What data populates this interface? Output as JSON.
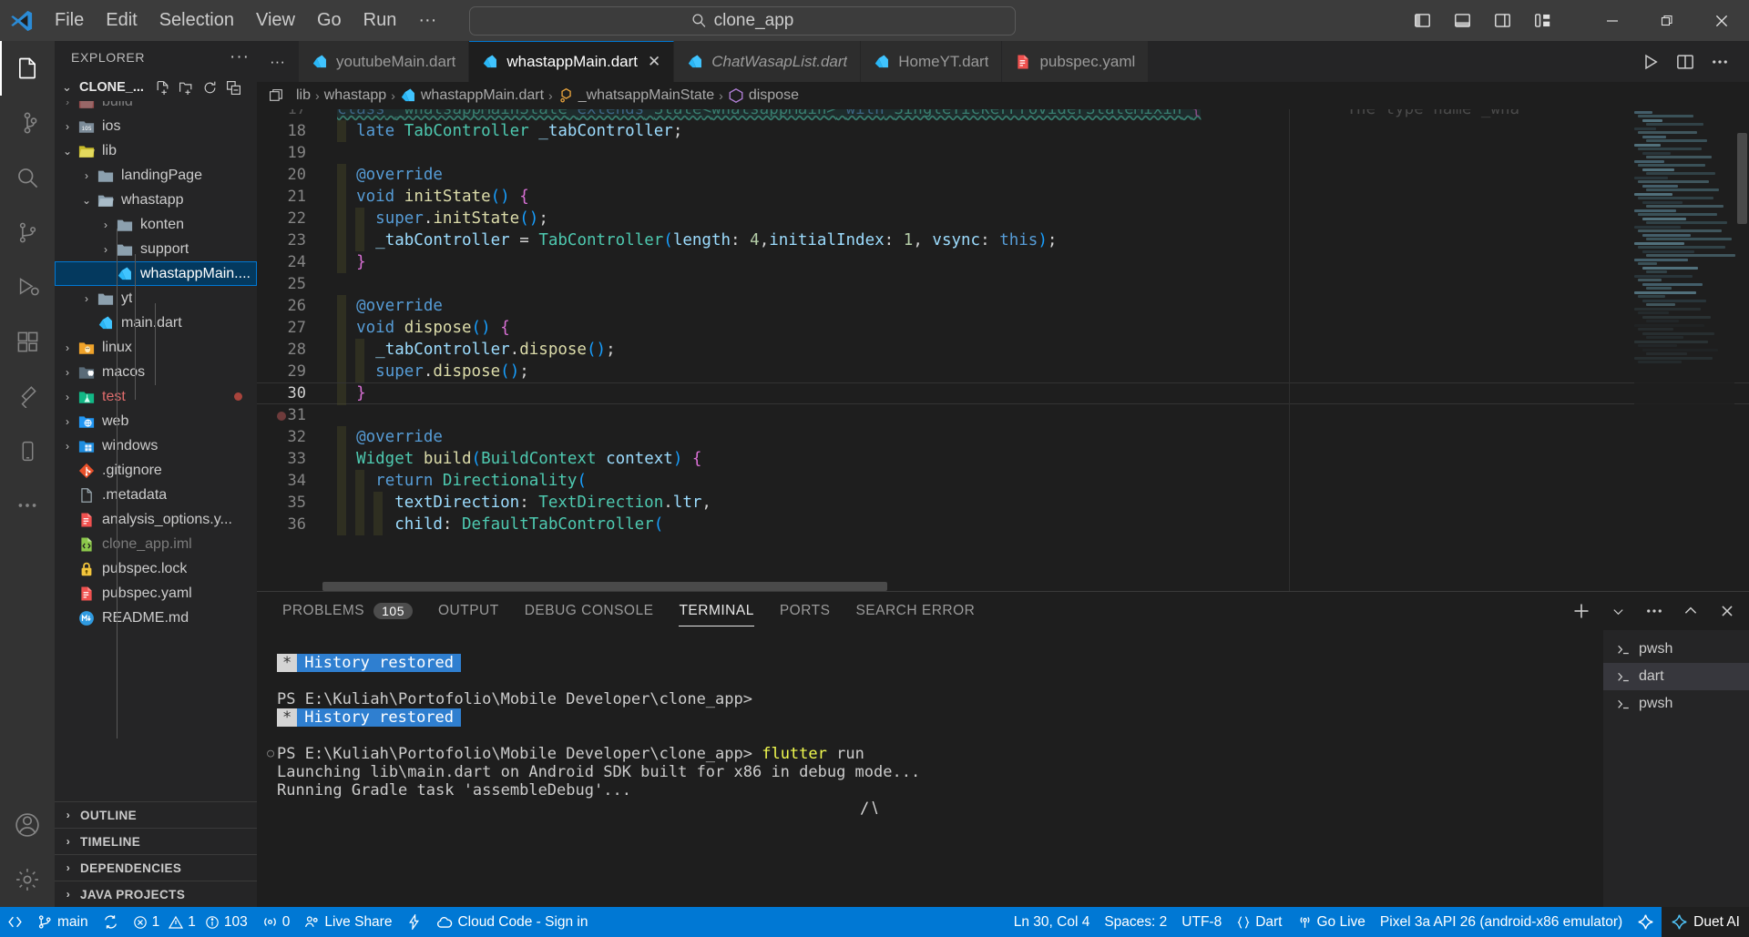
{
  "titlebar": {
    "logo": "vscode-logo",
    "menus": [
      "File",
      "Edit",
      "Selection",
      "View",
      "Go",
      "Run",
      "···"
    ],
    "nav_back": "←",
    "nav_forward": "→",
    "command_center": {
      "icon": "search-icon",
      "text": "clone_app"
    },
    "layout_icons": [
      "toggle-primary-sidebar-icon",
      "toggle-panel-icon",
      "toggle-secondary-sidebar-icon",
      "customize-layout-icon"
    ],
    "window_controls": {
      "minimize": "—",
      "restore": "❐",
      "close": "✕"
    }
  },
  "activitybar": {
    "items": [
      {
        "name": "explorer",
        "icon": "files-icon",
        "active": true,
        "badge": ""
      },
      {
        "name": "source-control",
        "icon": "source-control-icon",
        "active": false,
        "badge": ""
      },
      {
        "name": "search",
        "icon": "search-icon",
        "active": false,
        "badge": ""
      },
      {
        "name": "source-control-graph",
        "icon": "branch-icon",
        "active": false,
        "badge": ""
      },
      {
        "name": "run-and-debug",
        "icon": "debug-icon",
        "active": false,
        "badge": ""
      },
      {
        "name": "extensions",
        "icon": "extensions-icon",
        "active": false,
        "badge": ""
      },
      {
        "name": "flutter",
        "icon": "flutter-icon",
        "active": false,
        "badge": ""
      },
      {
        "name": "mobile-preview",
        "icon": "device-icon",
        "active": false,
        "badge": ""
      },
      {
        "name": "more-views",
        "icon": "ellipsis-icon",
        "active": false,
        "badge": ""
      }
    ],
    "bottom": [
      {
        "name": "accounts",
        "icon": "account-icon"
      },
      {
        "name": "manage",
        "icon": "gear-icon"
      }
    ]
  },
  "sidebar": {
    "title": "EXPLORER",
    "more_actions": "···",
    "root": {
      "chevron": "⌄",
      "label": "CLONE_...",
      "actions": [
        "new-file-icon",
        "new-folder-icon",
        "refresh-icon",
        "collapse-all-icon"
      ]
    },
    "tree": [
      {
        "label": "build",
        "type": "folder",
        "indent": 1,
        "twist": "›",
        "icon": "folder-build",
        "state": "cut"
      },
      {
        "label": "ios",
        "type": "folder",
        "indent": 1,
        "twist": "›",
        "icon": "folder-ios"
      },
      {
        "label": "lib",
        "type": "folder",
        "indent": 1,
        "twist": "⌄",
        "icon": "folder-lib-open"
      },
      {
        "label": "landingPage",
        "type": "folder",
        "indent": 2,
        "twist": "›",
        "icon": "folder-generic"
      },
      {
        "label": "whastapp",
        "type": "folder",
        "indent": 2,
        "twist": "⌄",
        "icon": "folder-generic-open"
      },
      {
        "label": "konten",
        "type": "folder",
        "indent": 3,
        "twist": "›",
        "icon": "folder-generic"
      },
      {
        "label": "support",
        "type": "folder",
        "indent": 3,
        "twist": "›",
        "icon": "folder-generic"
      },
      {
        "label": "whastappMain....",
        "type": "file",
        "indent": 3,
        "twist": "",
        "icon": "dart-icon",
        "selected": true
      },
      {
        "label": "yt",
        "type": "folder",
        "indent": 2,
        "twist": "›",
        "icon": "folder-generic"
      },
      {
        "label": "main.dart",
        "type": "file",
        "indent": 2,
        "twist": "",
        "icon": "dart-icon"
      },
      {
        "label": "linux",
        "type": "folder",
        "indent": 1,
        "twist": "›",
        "icon": "folder-linux"
      },
      {
        "label": "macos",
        "type": "folder",
        "indent": 1,
        "twist": "›",
        "icon": "folder-macos"
      },
      {
        "label": "test",
        "type": "folder",
        "indent": 1,
        "twist": "›",
        "icon": "folder-test",
        "modified": true
      },
      {
        "label": "web",
        "type": "folder",
        "indent": 1,
        "twist": "›",
        "icon": "folder-web"
      },
      {
        "label": "windows",
        "type": "folder",
        "indent": 1,
        "twist": "›",
        "icon": "folder-windows"
      },
      {
        "label": ".gitignore",
        "type": "file",
        "indent": 1,
        "twist": "",
        "icon": "git-icon"
      },
      {
        "label": ".metadata",
        "type": "file",
        "indent": 1,
        "twist": "",
        "icon": "plain-file-icon"
      },
      {
        "label": "analysis_options.y...",
        "type": "file",
        "indent": 1,
        "twist": "",
        "icon": "yaml-icon"
      },
      {
        "label": "clone_app.iml",
        "type": "file",
        "indent": 1,
        "twist": "",
        "icon": "xml-icon",
        "dim": true
      },
      {
        "label": "pubspec.lock",
        "type": "file",
        "indent": 1,
        "twist": "",
        "icon": "lock-icon"
      },
      {
        "label": "pubspec.yaml",
        "type": "file",
        "indent": 1,
        "twist": "",
        "icon": "yaml-icon"
      },
      {
        "label": "README.md",
        "type": "file",
        "indent": 1,
        "twist": "",
        "icon": "markdown-icon"
      }
    ],
    "sections": [
      {
        "label": "OUTLINE",
        "chevron": "›"
      },
      {
        "label": "TIMELINE",
        "chevron": "›"
      },
      {
        "label": "DEPENDENCIES",
        "chevron": "›"
      },
      {
        "label": "JAVA PROJECTS",
        "chevron": "›"
      }
    ]
  },
  "editor": {
    "tabs": [
      {
        "label": "youtubeMain.dart",
        "icon": "dart-icon",
        "active": false,
        "italic": false,
        "closable": false
      },
      {
        "label": "whastappMain.dart",
        "icon": "dart-icon",
        "active": true,
        "italic": false,
        "closable": true,
        "close": "✕"
      },
      {
        "label": "ChatWasapList.dart",
        "icon": "dart-icon",
        "active": false,
        "italic": true,
        "closable": false
      },
      {
        "label": "HomeYT.dart",
        "icon": "dart-icon",
        "active": false,
        "italic": false,
        "closable": false
      },
      {
        "label": "pubspec.yaml",
        "icon": "yaml-icon",
        "active": false,
        "italic": false,
        "closable": false
      }
    ],
    "tab_overflow": "···",
    "tab_actions": [
      "run-icon",
      "split-editor-icon",
      "more-actions-icon"
    ],
    "breadcrumb": [
      {
        "label": "lib",
        "icon": ""
      },
      {
        "label": "whastapp",
        "icon": ""
      },
      {
        "label": "whastappMain.dart",
        "icon": "dart-icon"
      },
      {
        "label": "_whatsappMainState",
        "icon": "class-icon"
      },
      {
        "label": "dispose",
        "icon": "method-icon"
      }
    ],
    "breadcrumb_sep": "›",
    "first_line_number": 17,
    "lines": [
      {
        "n": 17,
        "text": "class _whatsappMainState extends State<whatsappMain> with SingleTickerProviderStateMixin {",
        "ghost": "The type name _wha"
      },
      {
        "n": 18,
        "text": "  late TabController _tabController;"
      },
      {
        "n": 19,
        "text": ""
      },
      {
        "n": 20,
        "text": "  @override"
      },
      {
        "n": 21,
        "text": "  void initState() {"
      },
      {
        "n": 22,
        "text": "    super.initState();"
      },
      {
        "n": 23,
        "text": "    _tabController = TabController(length: 4,initialIndex: 1, vsync: this);"
      },
      {
        "n": 24,
        "text": "  }"
      },
      {
        "n": 25,
        "text": ""
      },
      {
        "n": 26,
        "text": "  @override"
      },
      {
        "n": 27,
        "text": "  void dispose() {"
      },
      {
        "n": 28,
        "text": "    _tabController.dispose();"
      },
      {
        "n": 29,
        "text": "    super.dispose();"
      },
      {
        "n": 30,
        "text": "  }",
        "current": true
      },
      {
        "n": 31,
        "text": ""
      },
      {
        "n": 32,
        "text": "  @override"
      },
      {
        "n": 33,
        "text": "  Widget build(BuildContext context) {"
      },
      {
        "n": 34,
        "text": "    return Directionality("
      },
      {
        "n": 35,
        "text": "      textDirection: TextDirection.ltr,"
      },
      {
        "n": 36,
        "text": "      child: DefaultTabController("
      }
    ]
  },
  "panel": {
    "tabs": [
      {
        "label": "PROBLEMS",
        "count": "105",
        "active": false
      },
      {
        "label": "OUTPUT",
        "count": "",
        "active": false
      },
      {
        "label": "DEBUG CONSOLE",
        "count": "",
        "active": false
      },
      {
        "label": "TERMINAL",
        "count": "",
        "active": true
      },
      {
        "label": "PORTS",
        "count": "",
        "active": false
      },
      {
        "label": "SEARCH ERROR",
        "count": "",
        "active": false
      }
    ],
    "actions": [
      "new-terminal-icon",
      "chevron-down-icon",
      "more-actions-icon",
      "maximize-panel-icon",
      "close-panel-icon"
    ],
    "terminal_lines": [
      {
        "kind": "blank",
        "text": ""
      },
      {
        "kind": "history",
        "star": "*",
        "text": "History restored"
      },
      {
        "kind": "blank",
        "text": ""
      },
      {
        "kind": "plain",
        "text": "PS E:\\Kuliah\\Portofolio\\Mobile Developer\\clone_app>"
      },
      {
        "kind": "history",
        "star": "*",
        "text": "History restored"
      },
      {
        "kind": "blank",
        "text": ""
      },
      {
        "kind": "prompt",
        "gutter": "○",
        "prefix": "PS E:\\Kuliah\\Portofolio\\Mobile Developer\\clone_app> ",
        "cmd": "flutter",
        "arg": " run"
      },
      {
        "kind": "plain",
        "text": "Launching lib\\main.dart on Android SDK built for x86 in debug mode..."
      },
      {
        "kind": "plain",
        "text": "Running Gradle task 'assembleDebug'..."
      },
      {
        "kind": "spinner",
        "text": "∕∖"
      }
    ],
    "terminal_list": [
      {
        "label": "pwsh",
        "icon": "terminal-icon",
        "active": false
      },
      {
        "label": "dart",
        "icon": "terminal-icon",
        "active": true
      },
      {
        "label": "pwsh",
        "icon": "terminal-icon",
        "active": false
      }
    ]
  },
  "statusbar": {
    "left": [
      {
        "name": "remote",
        "icon": "remote-icon",
        "label": ""
      },
      {
        "name": "branch",
        "icon": "branch-icon",
        "label": "main"
      },
      {
        "name": "sync",
        "icon": "sync-icon",
        "label": ""
      },
      {
        "name": "errors",
        "icon": "error-icon",
        "label": "1"
      },
      {
        "name": "warnings",
        "icon": "warning-icon",
        "label": "1"
      },
      {
        "name": "infos",
        "icon": "info-icon",
        "label": "103"
      },
      {
        "name": "ports",
        "icon": "radio-tower-icon",
        "label": "0"
      },
      {
        "name": "live-share",
        "icon": "live-share-icon",
        "label": "Live Share"
      },
      {
        "name": "flutter-lightning",
        "icon": "zap-icon",
        "label": ""
      },
      {
        "name": "cloud-code",
        "icon": "cloud-icon",
        "label": "Cloud Code - Sign in"
      }
    ],
    "right": [
      {
        "name": "cursor-position",
        "icon": "",
        "label": "Ln 30, Col 4"
      },
      {
        "name": "indentation",
        "icon": "",
        "label": "Spaces: 2"
      },
      {
        "name": "encoding",
        "icon": "",
        "label": "UTF-8"
      },
      {
        "name": "language-mode",
        "icon": "braces-icon",
        "label": "Dart"
      },
      {
        "name": "go-live",
        "icon": "broadcast-icon",
        "label": "Go Live"
      },
      {
        "name": "device-selector",
        "icon": "",
        "label": "Pixel 3a API 26 (android-x86 emulator)"
      },
      {
        "name": "gemini",
        "icon": "gemini-icon",
        "label": ""
      }
    ],
    "duet": {
      "icon": "duet-ai-icon",
      "label": "Duet AI"
    }
  },
  "colors": {
    "accent": "#0078d4",
    "titlebar_bg": "#3c3c3c",
    "sidebar_bg": "#252526",
    "editor_bg": "#1e1e1e",
    "activitybar_bg": "#333333",
    "selected_row": "#04395e",
    "terminal_highlight": "#2f7fd0",
    "error_red": "#e06c6c",
    "dart_blue": "#40c4ff"
  }
}
